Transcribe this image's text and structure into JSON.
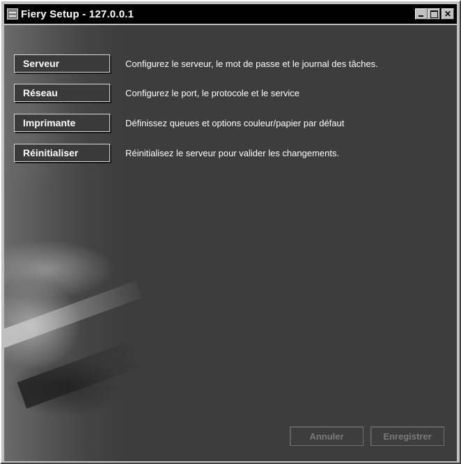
{
  "window": {
    "title": "Fiery Setup - 127.0.0.1",
    "icon": "app-window-icon",
    "controls": [
      "minimize-icon",
      "maximize-icon",
      "close-icon"
    ]
  },
  "menu": [
    {
      "label": "Serveur",
      "description": "Configurez le serveur, le mot de passe et le journal des tâches."
    },
    {
      "label": "Réseau",
      "description": "Configurez le port, le protocole et le service"
    },
    {
      "label": "Imprimante",
      "description": "Définissez queues et options couleur/papier par défaut"
    },
    {
      "label": "Réinitialiser",
      "description": "Réinitialisez le serveur pour valider les changements."
    }
  ],
  "footer": {
    "cancel_label": "Annuler",
    "save_label": "Enregistrer"
  }
}
